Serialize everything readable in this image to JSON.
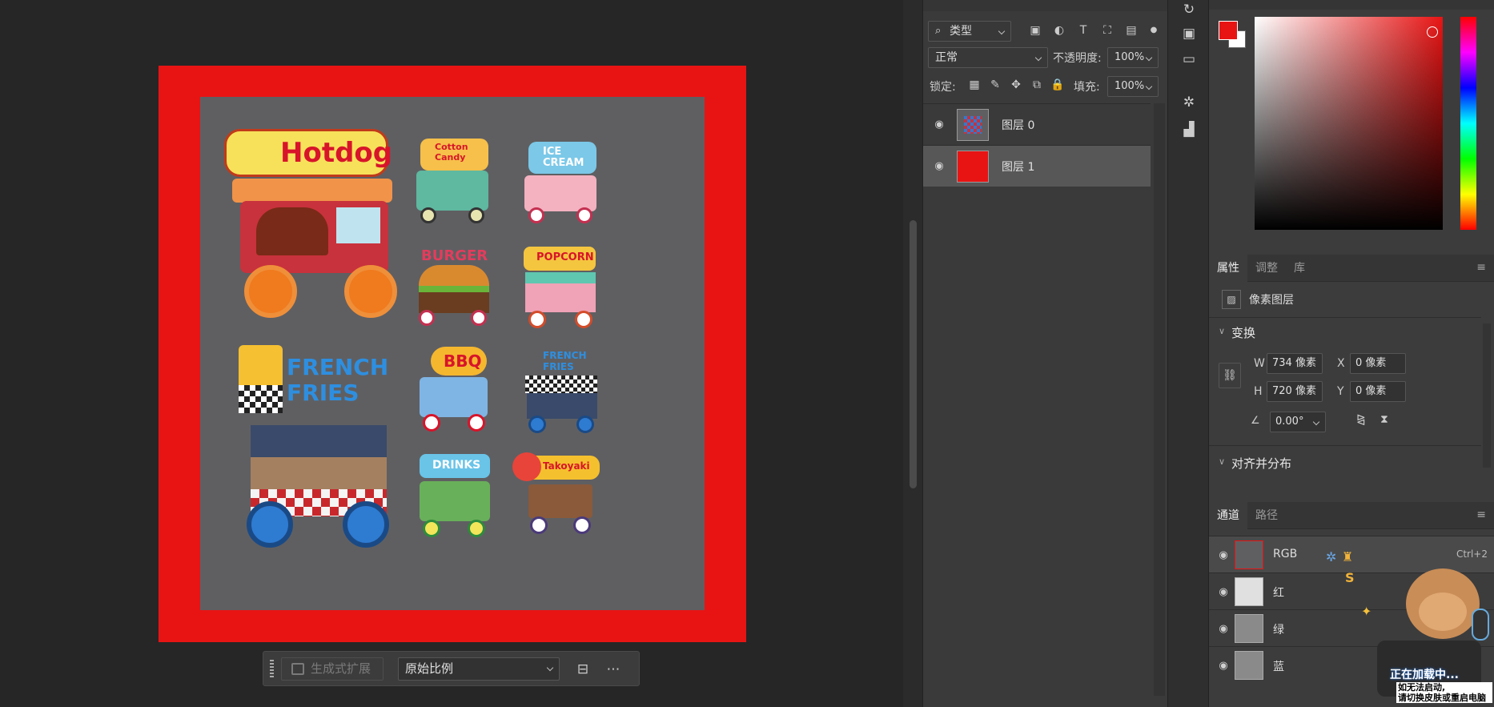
{
  "context_bar": {
    "generate_expand": "生成式扩展",
    "ratio_value": "原始比例"
  },
  "layers_panel": {
    "filter_kind": "类型",
    "blend_mode": "正常",
    "opacity_label": "不透明度:",
    "opacity_value": "100%",
    "lock_label": "锁定:",
    "fill_label": "填充:",
    "fill_value": "100%",
    "layers": [
      {
        "name": "图层 0",
        "active": false
      },
      {
        "name": "图层 1",
        "active": true
      }
    ]
  },
  "color": {
    "foreground": "#e81414",
    "background": "#ffffff"
  },
  "properties": {
    "tabs": [
      "属性",
      "调整",
      "库"
    ],
    "layer_type": "像素图层",
    "transform_title": "变换",
    "w_label": "W",
    "w_value": "734 像素",
    "h_label": "H",
    "h_value": "720 像素",
    "x_label": "X",
    "x_value": "0 像素",
    "y_label": "Y",
    "y_value": "0 像素",
    "angle_value": "0.00°",
    "align_title": "对齐并分布"
  },
  "channels": {
    "tabs": [
      "通道",
      "路径"
    ],
    "rows": [
      {
        "name": "RGB",
        "shortcut": "Ctrl+2"
      },
      {
        "name": "红",
        "shortcut": ""
      },
      {
        "name": "绿",
        "shortcut": ""
      },
      {
        "name": "蓝",
        "shortcut": ""
      }
    ]
  },
  "mascot": {
    "loading": "正在加载中...",
    "hint_line1": "如无法启动,",
    "hint_line2": "请切换皮肤或重启电脑"
  },
  "artwork_labels": {
    "hotdog": "Hotdog",
    "cotton_candy": "Cotton Candy",
    "ice_cream": "ICE CREAM",
    "burger": "BURGER",
    "popcorn": "POPCORN",
    "french_fries": "FRENCH FRIES",
    "bbq": "BBQ",
    "drinks": "DRINKS",
    "takoyaki": "Takoyaki"
  }
}
